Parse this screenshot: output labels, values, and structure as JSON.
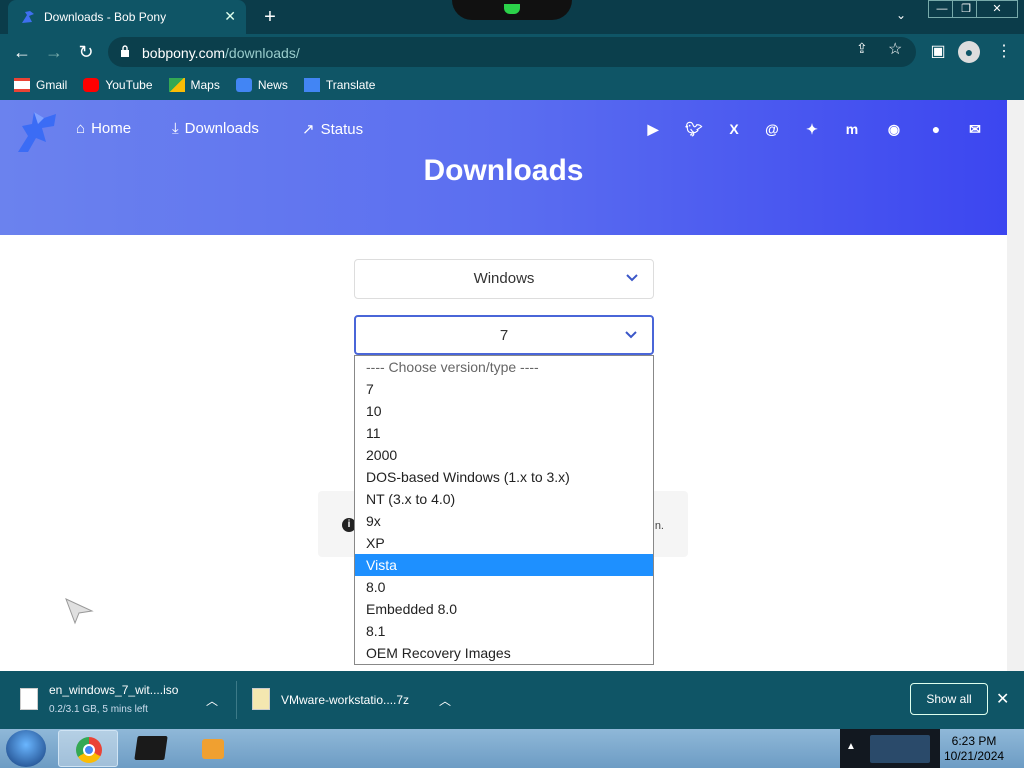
{
  "browser": {
    "tab_title": "Downloads - Bob Pony",
    "new_tab_label": "+",
    "close_tab_label": "✕",
    "tab_search_label": "⌄",
    "window_controls": {
      "minimize": "—",
      "maximize": "❐",
      "close": "✕"
    },
    "url_domain": "bobpony.com",
    "url_path": "/downloads/"
  },
  "bookmarks": [
    {
      "label": "Gmail",
      "icon": "gmail-icon",
      "color": "#ea4335"
    },
    {
      "label": "YouTube",
      "icon": "youtube-icon",
      "color": "#ff0000"
    },
    {
      "label": "Maps",
      "icon": "maps-icon",
      "color": "#34a853"
    },
    {
      "label": "News",
      "icon": "news-icon",
      "color": "#4285f4"
    },
    {
      "label": "Translate",
      "icon": "translate-icon",
      "color": "#4285f4"
    }
  ],
  "site": {
    "nav": [
      {
        "label": "Home",
        "icon": "home-icon"
      },
      {
        "label": "Downloads",
        "icon": "download-icon"
      },
      {
        "label": "Status",
        "icon": "chart-trend-icon"
      }
    ],
    "social_icons": [
      "youtube-icon",
      "twitter-icon",
      "x-icon",
      "threads-icon",
      "bluesky-icon",
      "mastodon-icon",
      "discord-icon",
      "github-icon",
      "mail-icon"
    ],
    "page_title": "Downloads",
    "os_select": {
      "value": "Windows"
    },
    "version_select": {
      "value": "7",
      "options": [
        "---- Choose version/type ----",
        "7",
        "10",
        "11",
        "2000",
        "DOS-based Windows (1.x to 3.x)",
        "NT (3.x to 4.0)",
        "9x",
        "XP",
        "Vista",
        "8.0",
        "Embedded 8.0",
        "8.1",
        "OEM Recovery Images"
      ],
      "highlighted": "Vista"
    },
    "notice_tail": "n.",
    "gradient": [
      "#6b82ee",
      "#3c46f0"
    ]
  },
  "downloads_shelf": {
    "items": [
      {
        "name": "en_windows_7_wit....iso",
        "meta": "0.2/3.1 GB, 5 mins left"
      },
      {
        "name": "VMware-workstatio....7z",
        "meta": ""
      }
    ],
    "show_all_label": "Show all"
  },
  "taskbar": {
    "time": "6:23 PM",
    "date": "10/21/2024"
  }
}
